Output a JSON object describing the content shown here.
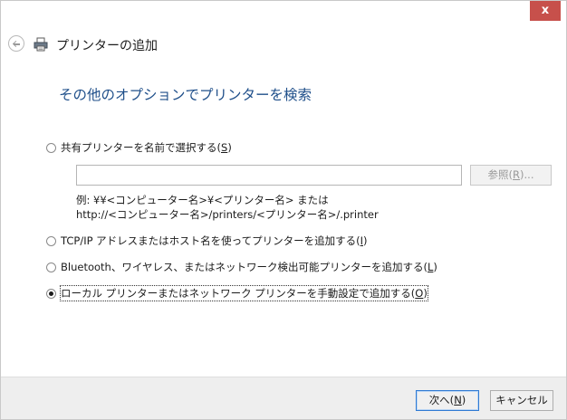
{
  "window": {
    "close_label": "x",
    "header_title": "プリンターの追加"
  },
  "icons": {
    "back": "back-arrow-icon",
    "printer": "printer-icon"
  },
  "main": {
    "title": "その他のオプションでプリンターを検索"
  },
  "options": {
    "shared": {
      "text": "共有プリンターを名前で選択する(",
      "key": "S",
      "close": ")",
      "checked": false
    },
    "tcpip": {
      "text": "TCP/IP アドレスまたはホスト名を使ってプリンターを追加する(",
      "key": "I",
      "close": ")",
      "checked": false
    },
    "bluetooth": {
      "text": "Bluetooth、ワイヤレス、またはネットワーク検出可能プリンターを追加する(",
      "key": "L",
      "close": ")",
      "checked": false
    },
    "local": {
      "text": "ローカル プリンターまたはネットワーク プリンターを手動設定で追加する(",
      "key": "O",
      "close": ")",
      "checked": true
    }
  },
  "shared_printer": {
    "input_value": "",
    "browse_text": "参照(",
    "browse_key": "R",
    "browse_close": ")...",
    "example_line1": "例: ¥¥<コンピューター名>¥<プリンター名> または",
    "example_line2": "http://<コンピューター名>/printers/<プリンター名>/.printer"
  },
  "footer": {
    "next_text": "次へ(",
    "next_key": "N",
    "next_close": ")",
    "cancel_label": "キャンセル"
  },
  "colors": {
    "accent_title": "#1f4f8a",
    "close_button": "#c7504b",
    "footer_bg": "#eeeeee",
    "default_button_border": "#2f7ad3"
  }
}
